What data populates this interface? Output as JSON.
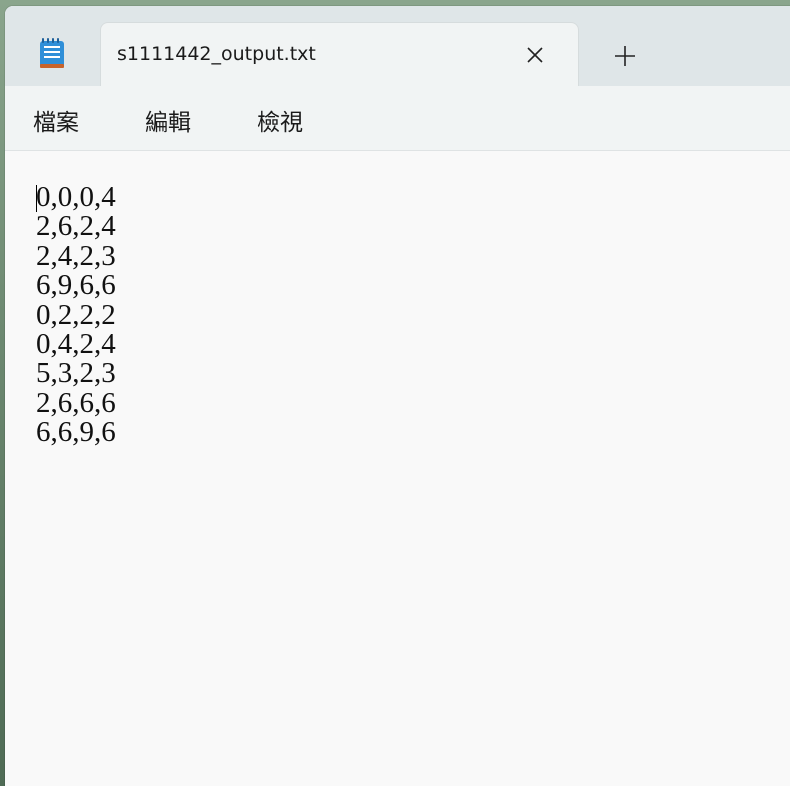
{
  "window": {
    "tab_title": "s1111442_output.txt",
    "icon": "notepad-icon"
  },
  "menu": {
    "items": [
      "檔案",
      "編輯",
      "檢視"
    ]
  },
  "editor": {
    "lines": [
      "0,0,0,4",
      "2,6,2,4",
      "2,4,2,3",
      "6,9,6,6",
      "0,2,2,2",
      "0,4,2,4",
      "5,3,2,3",
      "2,6,6,6",
      "6,6,9,6"
    ]
  }
}
